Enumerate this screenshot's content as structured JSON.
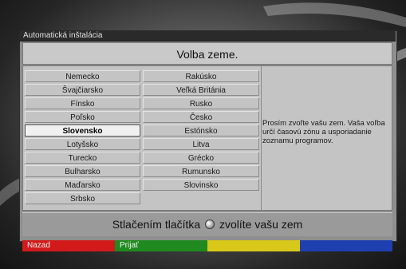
{
  "window": {
    "title": "Automatická inštalácia"
  },
  "main": {
    "heading": "Volba zeme.",
    "countries_left": [
      "Nemecko",
      "Švajčiarsko",
      "Fínsko",
      "Poľsko",
      "Slovensko",
      "Lotyšsko",
      "Turecko",
      "Bulharsko",
      "Maďarsko",
      "Srbsko"
    ],
    "countries_right": [
      "Rakúsko",
      "Veľká Británia",
      "Rusko",
      "Česko",
      "Estónsko",
      "Litva",
      "Grécko",
      "Rumunsko",
      "Slovinsko"
    ],
    "selected_country": "Slovensko",
    "info_text": "Prosím zvoľte vašu zem. Vaša voľba určí časovú zónu a usporiadanie zoznamu programov."
  },
  "hint": {
    "prefix": "Stlačením tlačítka",
    "suffix": "zvolíte vašu zem",
    "ok_icon": "ok-button-icon"
  },
  "footer": {
    "buttons": [
      {
        "label": "Nazad",
        "color": "#d21a1a"
      },
      {
        "label": "Prijať",
        "color": "#1f8a1f"
      },
      {
        "label": "",
        "color": "#d8c81a"
      },
      {
        "label": "",
        "color": "#1e3fb0"
      }
    ]
  }
}
